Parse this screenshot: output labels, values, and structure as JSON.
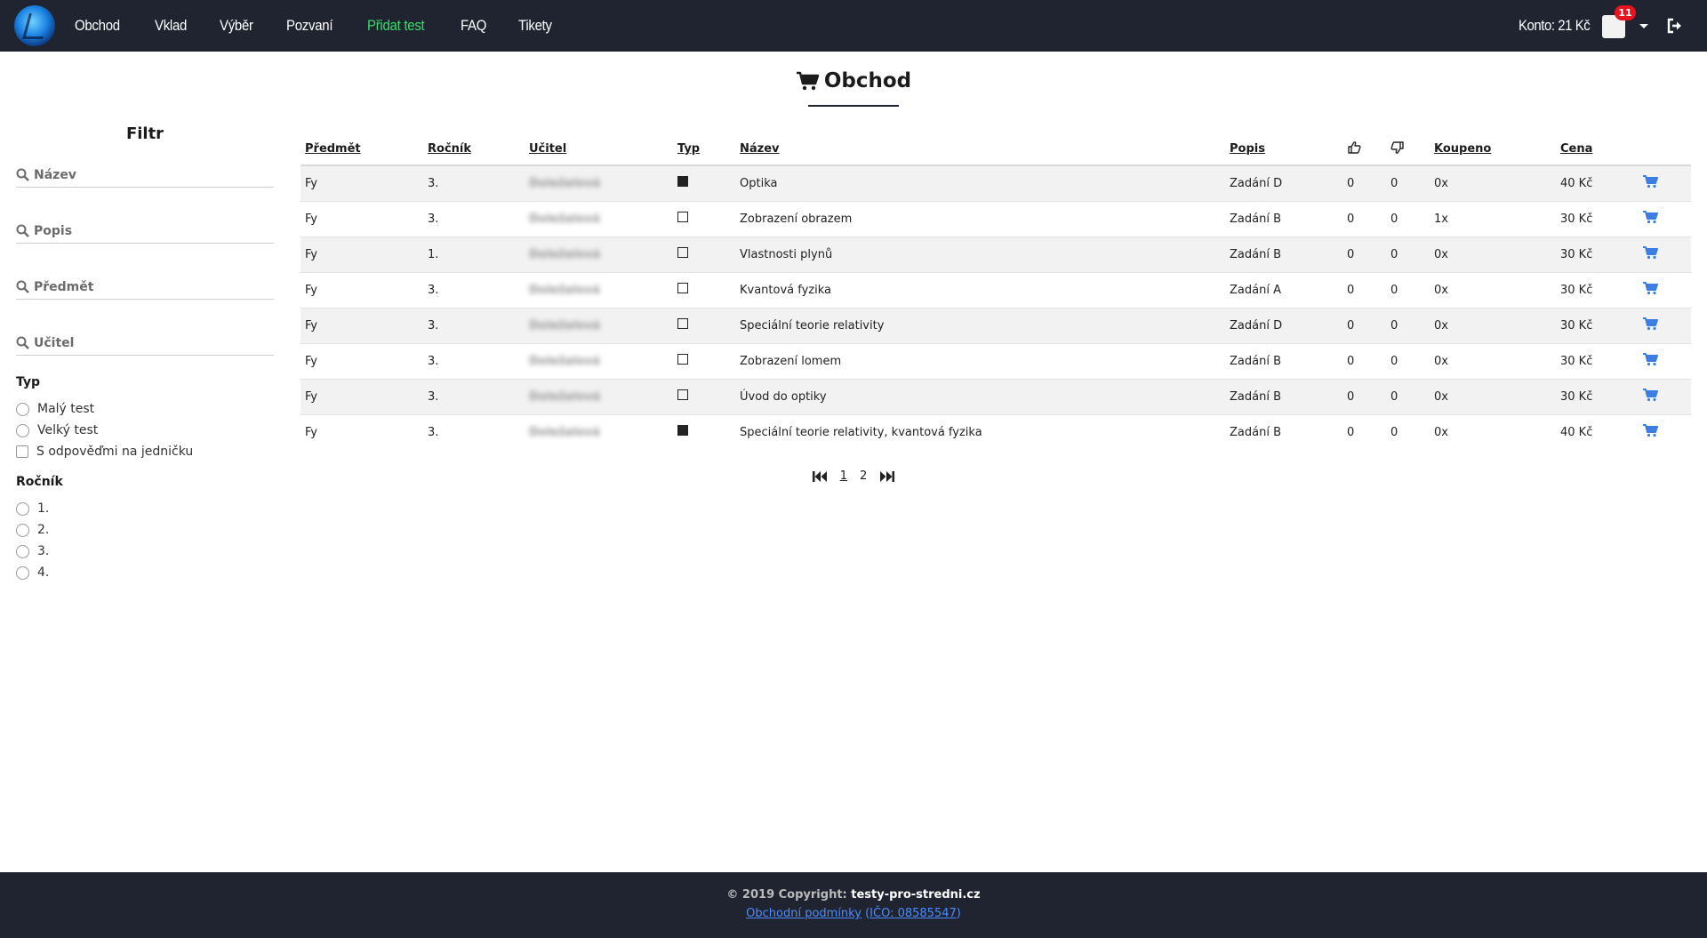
{
  "nav": {
    "links": [
      {
        "label": "Obchod",
        "active": false
      },
      {
        "label": "Vklad",
        "active": false
      },
      {
        "label": "Výběr",
        "active": false
      },
      {
        "label": "Pozvaní",
        "active": false
      },
      {
        "label": "Přidat test",
        "active": true
      },
      {
        "label": "FAQ",
        "active": false
      },
      {
        "label": "Tikety",
        "active": false
      }
    ],
    "account_label": "Konto: 21 Kč",
    "notification_count": "11",
    "active_color": "#3ddc6f"
  },
  "page": {
    "title": "Obchod"
  },
  "filter": {
    "title": "Filtr",
    "fields": [
      {
        "placeholder": "Název"
      },
      {
        "placeholder": "Popis"
      },
      {
        "placeholder": "Předmět"
      },
      {
        "placeholder": "Učitel"
      }
    ],
    "type_group": {
      "title": "Typ",
      "options": [
        "Malý test",
        "Velký test"
      ],
      "checkbox": "S odpověďmi na jedničku"
    },
    "grade_group": {
      "title": "Ročník",
      "options": [
        "1.",
        "2.",
        "3.",
        "4."
      ]
    }
  },
  "table": {
    "headers": {
      "subject": "Předmět",
      "grade": "Ročník",
      "teacher": "Učitel",
      "type": "Typ",
      "name": "Název",
      "description": "Popis",
      "bought": "Koupeno",
      "price": "Cena"
    },
    "rows": [
      {
        "subject": "Fy",
        "grade": "3.",
        "teacher": "Doležalová",
        "type_filled": true,
        "name": "Optika",
        "description": "Zadání D",
        "likes": "0",
        "dislikes": "0",
        "bought": "0x",
        "price": "40 Kč"
      },
      {
        "subject": "Fy",
        "grade": "3.",
        "teacher": "Doležalová",
        "type_filled": false,
        "name": "Zobrazení obrazem",
        "description": "Zadání B",
        "likes": "0",
        "dislikes": "0",
        "bought": "1x",
        "price": "30 Kč"
      },
      {
        "subject": "Fy",
        "grade": "1.",
        "teacher": "Doležalová",
        "type_filled": false,
        "name": "Vlastnosti plynů",
        "description": "Zadání B",
        "likes": "0",
        "dislikes": "0",
        "bought": "0x",
        "price": "30 Kč"
      },
      {
        "subject": "Fy",
        "grade": "3.",
        "teacher": "Doležalová",
        "type_filled": false,
        "name": "Kvantová fyzika",
        "description": "Zadání A",
        "likes": "0",
        "dislikes": "0",
        "bought": "0x",
        "price": "30 Kč"
      },
      {
        "subject": "Fy",
        "grade": "3.",
        "teacher": "Doležalová",
        "type_filled": false,
        "name": "Speciální teorie relativity",
        "description": "Zadání D",
        "likes": "0",
        "dislikes": "0",
        "bought": "0x",
        "price": "30 Kč"
      },
      {
        "subject": "Fy",
        "grade": "3.",
        "teacher": "Doležalová",
        "type_filled": false,
        "name": "Zobrazení lomem",
        "description": "Zadání B",
        "likes": "0",
        "dislikes": "0",
        "bought": "0x",
        "price": "30 Kč"
      },
      {
        "subject": "Fy",
        "grade": "3.",
        "teacher": "Doležalová",
        "type_filled": false,
        "name": "Úvod do optiky",
        "description": "Zadání B",
        "likes": "0",
        "dislikes": "0",
        "bought": "0x",
        "price": "30 Kč"
      },
      {
        "subject": "Fy",
        "grade": "3.",
        "teacher": "Doležalová",
        "type_filled": true,
        "name": "Speciální teorie relativity, kvantová fyzika",
        "description": "Zadání B",
        "likes": "0",
        "dislikes": "0",
        "bought": "0x",
        "price": "40 Kč"
      }
    ],
    "cart_color": "#3d7fe0"
  },
  "pagination": {
    "pages": [
      "1",
      "2"
    ],
    "current": "1"
  },
  "footer": {
    "copyright_prefix": "© 2019 Copyright:",
    "site": "testy-pro-stredni.cz",
    "terms_link": "Obchodní podmínky",
    "ico_link": "IČO: 08585547",
    "open_paren": "(",
    "close_paren": ")"
  }
}
